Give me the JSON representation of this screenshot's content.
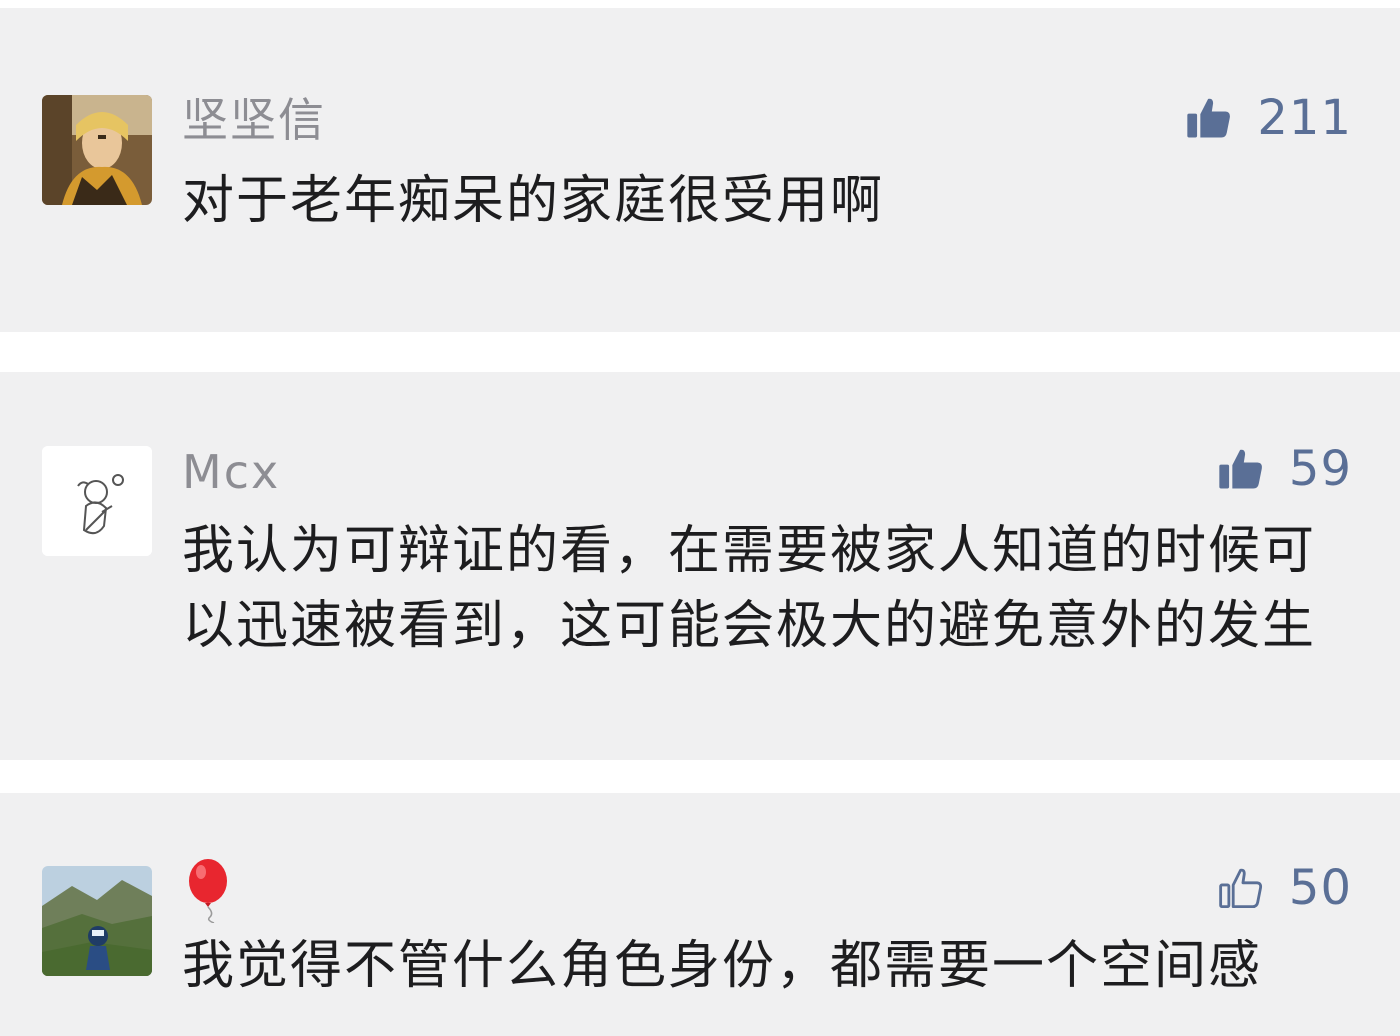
{
  "comments": [
    {
      "username": "坚坚信",
      "likes": "211",
      "like_icon": "thumbs-up-filled-icon",
      "text": "对于老年痴呆的家庭很受用啊"
    },
    {
      "username": "Mcx",
      "likes": "59",
      "like_icon": "thumbs-up-filled-icon",
      "text": "我认为可辩证的看，在需要被家人知道的时候可以迅速被看到，这可能会极大的避免意外的发生"
    },
    {
      "username": "🎈",
      "username_icon": "balloon-icon",
      "likes": "50",
      "like_icon": "thumbs-up-outline-icon",
      "text": "我觉得不管什么角色身份，都需要一个空间感"
    }
  ],
  "colors": {
    "card_bg": "#f0f0f1",
    "separator": "#ffffff",
    "username": "#8d8d93",
    "comment_text": "#1d1d1f",
    "like_accent": "#5a6f96",
    "balloon": "#e8262f"
  }
}
